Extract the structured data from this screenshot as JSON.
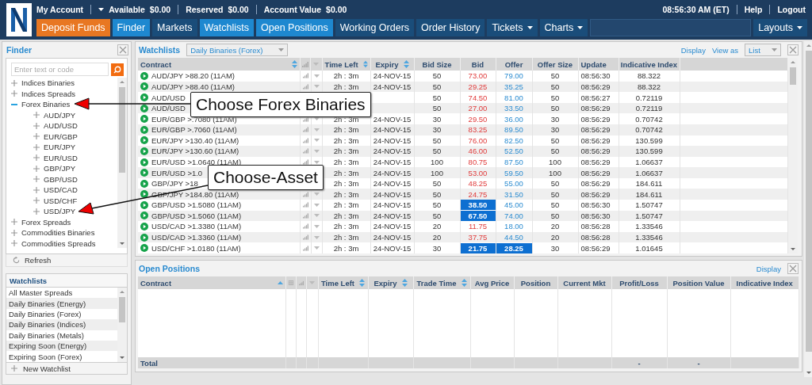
{
  "account_bar": {
    "account": "My Account",
    "available_label": "Available",
    "available": "$0.00",
    "reserved_label": "Reserved",
    "reserved": "$0.00",
    "account_value_label": "Account Value",
    "account_value": "$0.00",
    "time": "08:56:30 AM (ET)",
    "help": "Help",
    "logout": "Logout"
  },
  "nav": [
    {
      "label": "Deposit Funds",
      "kind": "deposit",
      "selected": false,
      "menu": false
    },
    {
      "label": "Finder",
      "kind": "tab",
      "selected": true,
      "menu": false
    },
    {
      "label": "Markets",
      "kind": "tab",
      "selected": false,
      "menu": false
    },
    {
      "label": "Watchlists",
      "kind": "tab",
      "selected": true,
      "menu": false
    },
    {
      "label": "Open Positions",
      "kind": "tab",
      "selected": true,
      "menu": false
    },
    {
      "label": "Working Orders",
      "kind": "tab",
      "selected": false,
      "menu": false
    },
    {
      "label": "Order History",
      "kind": "tab",
      "selected": false,
      "menu": false
    },
    {
      "label": "Tickets",
      "kind": "tab",
      "selected": false,
      "menu": true
    },
    {
      "label": "Charts",
      "kind": "tab",
      "selected": false,
      "menu": true
    }
  ],
  "layouts": "Layouts",
  "finder": {
    "title": "Finder",
    "placeholder": "Enter text or code",
    "tree": [
      {
        "label": "Indices Binaries",
        "expanded": false
      },
      {
        "label": "Indices Spreads",
        "expanded": false
      },
      {
        "label": "Forex Binaries",
        "expanded": true,
        "children": [
          {
            "label": "AUD/JPY",
            "expanded": false
          },
          {
            "label": "AUD/USD",
            "expanded": false
          },
          {
            "label": "EUR/GBP",
            "expanded": false
          },
          {
            "label": "EUR/JPY",
            "expanded": false
          },
          {
            "label": "EUR/USD",
            "expanded": false
          },
          {
            "label": "GBP/JPY",
            "expanded": false
          },
          {
            "label": "GBP/USD",
            "expanded": false
          },
          {
            "label": "USD/CAD",
            "expanded": false
          },
          {
            "label": "USD/CHF",
            "expanded": false
          },
          {
            "label": "USD/JPY",
            "expanded": false
          }
        ]
      },
      {
        "label": "Forex Spreads",
        "expanded": false
      },
      {
        "label": "Commodities Binaries",
        "expanded": false
      },
      {
        "label": "Commodities Spreads",
        "expanded": false
      }
    ],
    "refresh": "Refresh"
  },
  "watchlists_panel": {
    "title": "Watchlists",
    "items": [
      "All Master Spreads",
      "Daily Binaries (Energy)",
      "Daily Binaries (Forex)",
      "Daily Binaries (Indices)",
      "Daily Binaries (Metals)",
      "Expiring Soon (Energy)",
      "Expiring Soon (Forex)"
    ],
    "new_watchlist": "New Watchlist"
  },
  "watchlist": {
    "title": "Watchlists",
    "selector": "Daily Binaries (Forex)",
    "display": "Display",
    "view_as": "View as",
    "view_value": "List",
    "columns": [
      {
        "label": "Contract",
        "sortable": true
      },
      {
        "label": "Time Left",
        "sortable": true
      },
      {
        "label": "Expiry",
        "sortable": true
      },
      {
        "label": "Bid Size",
        "sortable": false
      },
      {
        "label": "Bid",
        "sortable": false
      },
      {
        "label": "Offer",
        "sortable": false
      },
      {
        "label": "Offer Size",
        "sortable": false
      },
      {
        "label": "Update",
        "sortable": false
      },
      {
        "label": "Indicative Index",
        "sortable": false
      }
    ],
    "rows": [
      {
        "contract": "AUD/JPY >88.20 (11AM)",
        "time_left": "2h : 3m",
        "expiry": "24-NOV-15",
        "bid_size": "50",
        "bid": "73.00",
        "offer": "79.00",
        "offer_size": "50",
        "update": "08:56:30",
        "index": "88.322",
        "bid_highlighted": false,
        "offer_highlighted": false
      },
      {
        "contract": "AUD/JPY >88.40 (11AM)",
        "time_left": "2h : 3m",
        "expiry": "24-NOV-15",
        "bid_size": "50",
        "bid": "29.25",
        "offer": "35.25",
        "offer_size": "50",
        "update": "08:56:29",
        "index": "88.322",
        "bid_highlighted": false,
        "offer_highlighted": false
      },
      {
        "contract": "AUD/USD",
        "bid_size": "50",
        "bid": "74.50",
        "offer": "81.00",
        "offer_size": "50",
        "update": "08:56:27",
        "index": "0.72119",
        "bid_highlighted": false,
        "offer_highlighted": false
      },
      {
        "contract": "AUD/USD",
        "bid_size": "50",
        "bid": "27.00",
        "offer": "33.50",
        "offer_size": "50",
        "update": "08:56:29",
        "index": "0.72119",
        "bid_highlighted": false,
        "offer_highlighted": false
      },
      {
        "contract": "EUR/GBP >.7080 (11AM)",
        "time_left": "2h : 3m",
        "expiry": "24-NOV-15",
        "bid_size": "30",
        "bid": "29.50",
        "offer": "36.00",
        "offer_size": "30",
        "update": "08:56:29",
        "index": "0.70742",
        "bid_highlighted": false,
        "offer_highlighted": false
      },
      {
        "contract": "EUR/GBP >.7060 (11AM)",
        "time_left": "2h : 3m",
        "expiry": "24-NOV-15",
        "bid_size": "30",
        "bid": "83.25",
        "offer": "89.50",
        "offer_size": "30",
        "update": "08:56:29",
        "index": "0.70742",
        "bid_highlighted": false,
        "offer_highlighted": false
      },
      {
        "contract": "EUR/JPY >130.40 (11AM)",
        "time_left": "2h : 3m",
        "expiry": "24-NOV-15",
        "bid_size": "50",
        "bid": "76.00",
        "offer": "82.50",
        "offer_size": "50",
        "update": "08:56:29",
        "index": "130.599",
        "bid_highlighted": false,
        "offer_highlighted": false
      },
      {
        "contract": "EUR/JPY >130.60 (11AM)",
        "time_left": "2h : 3m",
        "expiry": "24-NOV-15",
        "bid_size": "50",
        "bid": "46.00",
        "offer": "52.50",
        "offer_size": "50",
        "update": "08:56:29",
        "index": "130.599",
        "bid_highlighted": false,
        "offer_highlighted": false
      },
      {
        "contract": "EUR/USD >1.0640 (11AM)",
        "time_left": "2h : 3m",
        "expiry": "24-NOV-15",
        "bid_size": "100",
        "bid": "80.75",
        "offer": "87.50",
        "offer_size": "100",
        "update": "08:56:29",
        "index": "1.06637",
        "bid_highlighted": false,
        "offer_highlighted": false
      },
      {
        "contract": "EUR/USD >1.0",
        "time_left": "2h : 3m",
        "expiry": "24-NOV-15",
        "bid_size": "100",
        "bid": "53.00",
        "offer": "59.50",
        "offer_size": "100",
        "update": "08:56:29",
        "index": "1.06637",
        "bid_highlighted": false,
        "offer_highlighted": false
      },
      {
        "contract": "GBP/JPY >18",
        "time_left": "2h : 3m",
        "expiry": "24-NOV-15",
        "bid_size": "50",
        "bid": "48.25",
        "offer": "55.00",
        "offer_size": "50",
        "update": "08:56:29",
        "index": "184.611",
        "bid_highlighted": false,
        "offer_highlighted": false
      },
      {
        "contract": "GBP/JPY >184.80 (11AM)",
        "time_left": "2h : 3m",
        "expiry": "24-NOV-15",
        "bid_size": "50",
        "bid": "24.75",
        "offer": "31.50",
        "offer_size": "50",
        "update": "08:56:29",
        "index": "184.611",
        "bid_highlighted": false,
        "offer_highlighted": false
      },
      {
        "contract": "GBP/USD >1.5080 (11AM)",
        "time_left": "2h : 3m",
        "expiry": "24-NOV-15",
        "bid_size": "50",
        "bid": "38.50",
        "offer": "45.00",
        "offer_size": "50",
        "update": "08:56:30",
        "index": "1.50747",
        "bid_highlighted": true,
        "offer_highlighted": false
      },
      {
        "contract": "GBP/USD >1.5060 (11AM)",
        "time_left": "2h : 3m",
        "expiry": "24-NOV-15",
        "bid_size": "50",
        "bid": "67.50",
        "offer": "74.00",
        "offer_size": "50",
        "update": "08:56:30",
        "index": "1.50747",
        "bid_highlighted": true,
        "offer_highlighted": false
      },
      {
        "contract": "USD/CAD >1.3380 (11AM)",
        "time_left": "2h : 3m",
        "expiry": "24-NOV-15",
        "bid_size": "20",
        "bid": "11.75",
        "offer": "18.00",
        "offer_size": "20",
        "update": "08:56:28",
        "index": "1.33546",
        "bid_highlighted": false,
        "offer_highlighted": false
      },
      {
        "contract": "USD/CAD >1.3360 (11AM)",
        "time_left": "2h : 3m",
        "expiry": "24-NOV-15",
        "bid_size": "20",
        "bid": "37.75",
        "offer": "44.50",
        "offer_size": "20",
        "update": "08:56:28",
        "index": "1.33546",
        "bid_highlighted": false,
        "offer_highlighted": false
      },
      {
        "contract": "USD/CHF >1.0180 (11AM)",
        "time_left": "2h : 3m",
        "expiry": "24-NOV-15",
        "bid_size": "30",
        "bid": "21.75",
        "offer": "28.25",
        "offer_size": "30",
        "update": "08:56:29",
        "index": "1.01645",
        "bid_highlighted": true,
        "offer_highlighted": true
      }
    ]
  },
  "open_positions": {
    "title": "Open Positions",
    "display": "Display",
    "columns": [
      {
        "label": "Contract",
        "sortable": true
      },
      {
        "label": "Time Left",
        "sortable": true
      },
      {
        "label": "Expiry",
        "sortable": true
      },
      {
        "label": "Trade Time",
        "sortable": true
      },
      {
        "label": "Avg Price",
        "sortable": false
      },
      {
        "label": "Position",
        "sortable": false
      },
      {
        "label": "Current Mkt",
        "sortable": false
      },
      {
        "label": "Profit/Loss",
        "sortable": false
      },
      {
        "label": "Position Value",
        "sortable": false
      },
      {
        "label": "Indicative Index",
        "sortable": false
      }
    ],
    "total_label": "Total",
    "total_profit_loss": "-",
    "total_position_value": "-"
  },
  "callouts": [
    {
      "text": "Choose Forex Binaries"
    },
    {
      "text": "Choose-Asset"
    }
  ]
}
